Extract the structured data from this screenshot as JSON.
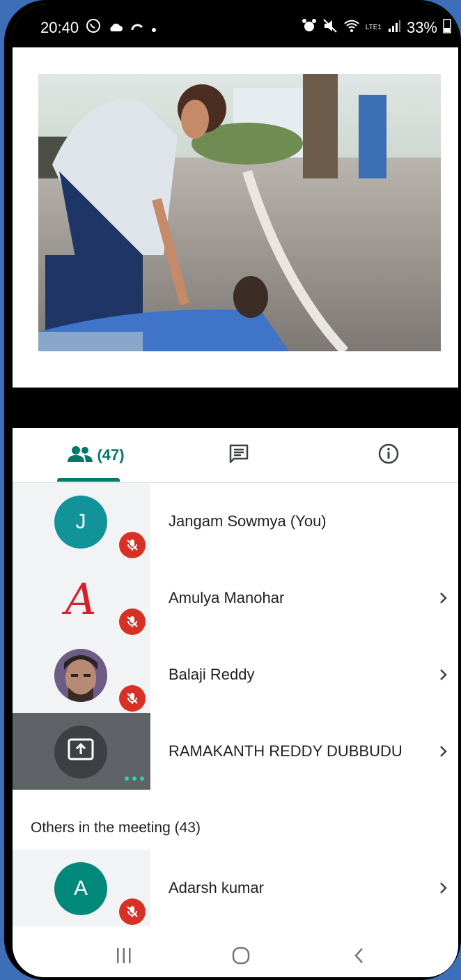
{
  "status_bar": {
    "time": "20:40",
    "battery": "33%",
    "network": "LTE1"
  },
  "tabs": {
    "people_count": "(47)",
    "active": "people"
  },
  "participants": [
    {
      "name": "Jangam Sowmya (You)",
      "avatar_letter": "J",
      "avatar_color": "#12939a",
      "muted": true,
      "has_chevron": false
    },
    {
      "name": "Amulya Manohar",
      "avatar_letter": "A",
      "avatar_style": "handwritten-red",
      "muted": true,
      "has_chevron": true
    },
    {
      "name": "Balaji Reddy",
      "avatar_style": "photo",
      "muted": true,
      "has_chevron": true
    },
    {
      "name": "RAMAKANTH REDDY DUBBUDU",
      "avatar_style": "presenting",
      "muted": false,
      "has_chevron": true
    }
  ],
  "others_section": {
    "label": "Others in the meeting (43)"
  },
  "others": [
    {
      "name": "Adarsh kumar",
      "avatar_letter": "A",
      "avatar_color": "#00897b",
      "muted": true,
      "has_chevron": true
    }
  ],
  "colors": {
    "accent": "#00796b",
    "mute_red": "#d93025"
  }
}
